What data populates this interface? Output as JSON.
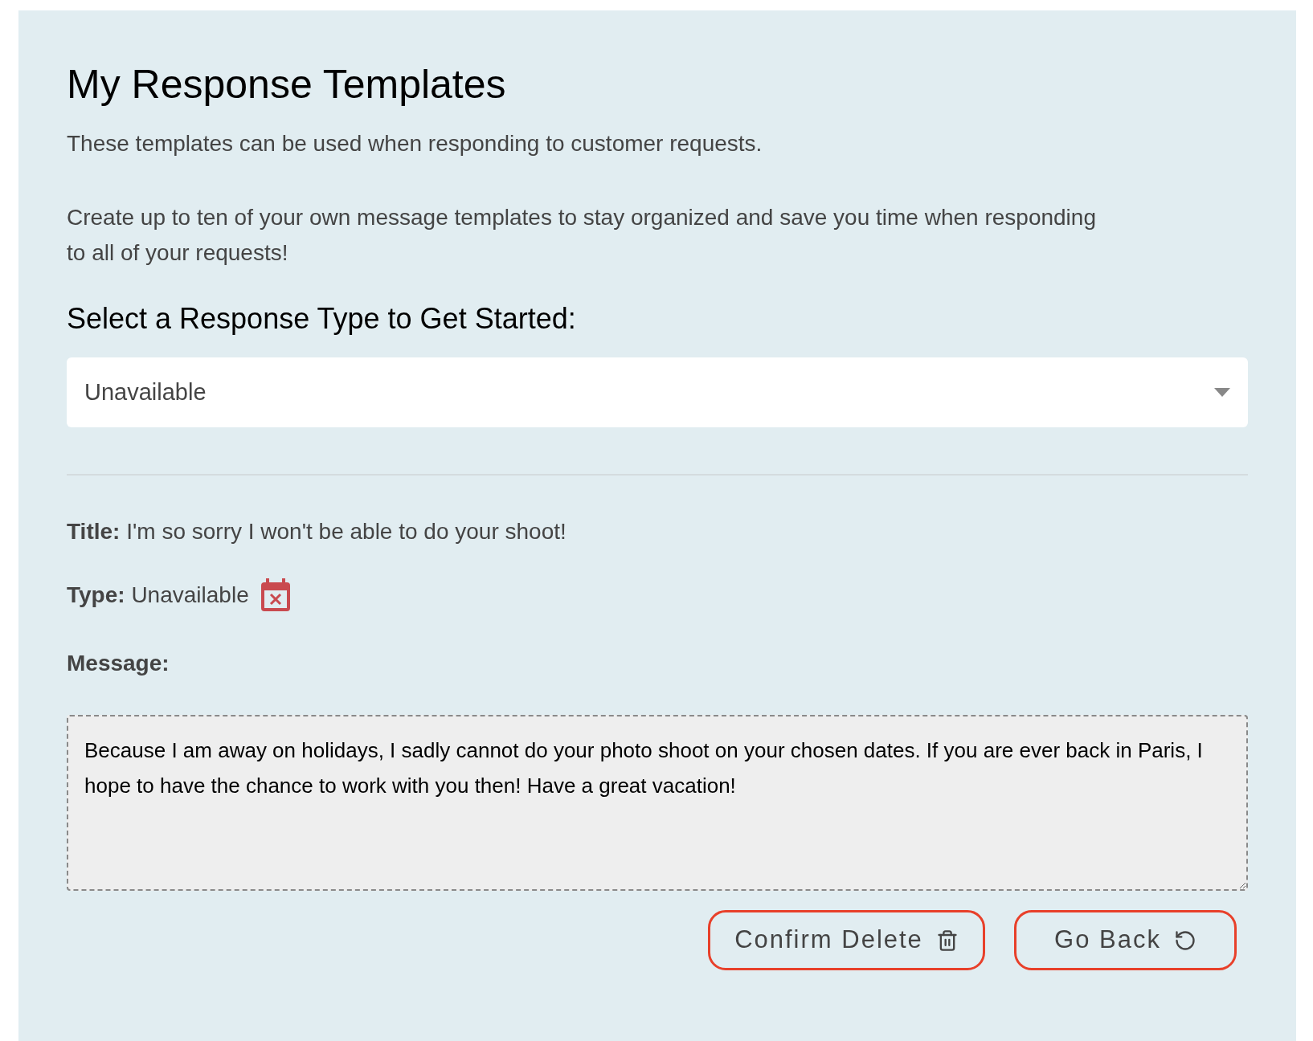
{
  "title": "My Response Templates",
  "intro": [
    "These templates can be used when responding to customer requests.",
    "Create up to ten of your own message templates to stay organized and save you time when responding to all of your requests!"
  ],
  "select_heading": "Select a Response Type to Get Started:",
  "response_type_select": {
    "value": "Unavailable"
  },
  "details": {
    "title_label": "Title:",
    "title_value": "I'm so sorry I won't be able to do your shoot!",
    "type_label": "Type:",
    "type_value": "Unavailable",
    "message_label": "Message:"
  },
  "message_field": {
    "value": "Because I am away on holidays, I sadly cannot do your photo shoot on your chosen dates. If you are ever back in Paris, I hope to have the chance to work with you then! Have a great vacation!"
  },
  "buttons": [
    {
      "label": "Confirm Delete",
      "kind": "delete"
    },
    {
      "label": "Go Back",
      "kind": "back"
    }
  ]
}
